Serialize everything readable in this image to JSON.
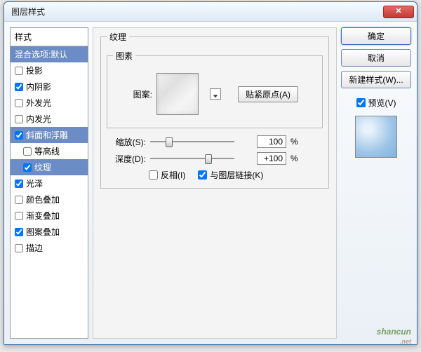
{
  "window": {
    "title": "图层样式"
  },
  "sidebar": {
    "header": "样式",
    "blend": "混合选项:默认",
    "items": [
      {
        "label": "投影",
        "checked": false
      },
      {
        "label": "内阴影",
        "checked": true
      },
      {
        "label": "外发光",
        "checked": false
      },
      {
        "label": "内发光",
        "checked": false
      },
      {
        "label": "斜面和浮雕",
        "checked": true,
        "selected": true
      },
      {
        "label": "等高线",
        "checked": false,
        "sub": true
      },
      {
        "label": "纹理",
        "checked": true,
        "sub": true,
        "selected": true
      },
      {
        "label": "光泽",
        "checked": true
      },
      {
        "label": "颜色叠加",
        "checked": false
      },
      {
        "label": "渐变叠加",
        "checked": false
      },
      {
        "label": "图案叠加",
        "checked": true
      },
      {
        "label": "描边",
        "checked": false
      }
    ]
  },
  "panel": {
    "group_title": "纹理",
    "element_group": "图素",
    "pattern_label": "图案:",
    "snap_button": "贴紧原点(A)",
    "scale": {
      "label": "缩放(S):",
      "value": "100",
      "unit": "%",
      "thumb_pct": 18
    },
    "depth": {
      "label": "深度(D):",
      "value": "+100",
      "unit": "%",
      "thumb_pct": 65
    },
    "invert": {
      "label": "反相(I)",
      "checked": false
    },
    "link": {
      "label": "与图层链接(K)",
      "checked": true
    }
  },
  "buttons": {
    "ok": "确定",
    "cancel": "取消",
    "newstyle": "新建样式(W)...",
    "preview_label": "预览(V)",
    "preview_checked": true
  },
  "watermark": {
    "text": "shancun",
    "sub": ".net"
  }
}
